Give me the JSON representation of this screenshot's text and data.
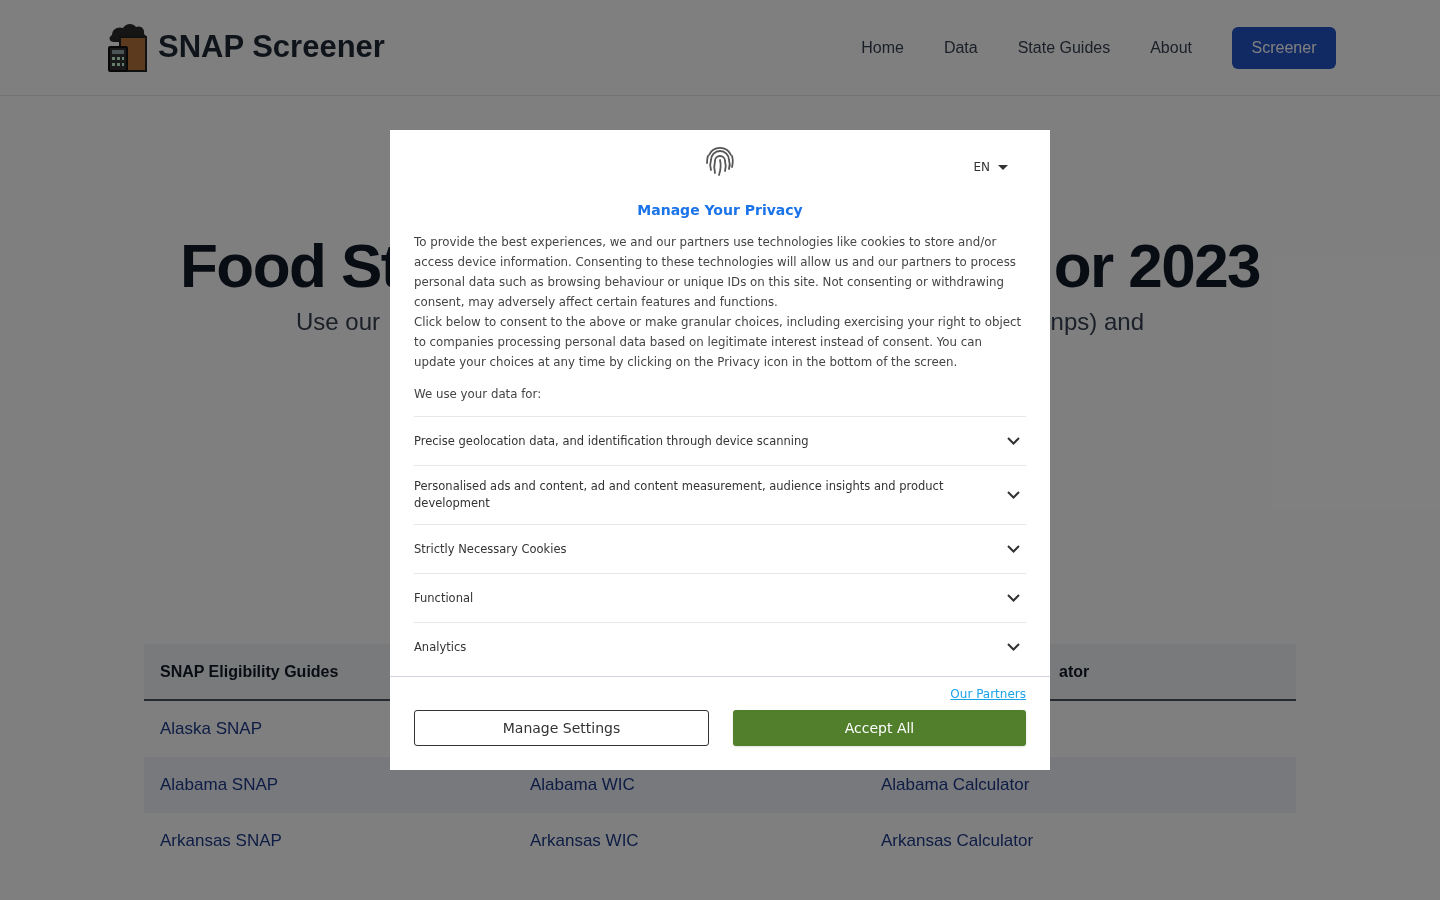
{
  "header": {
    "logo_text": "SNAP Screener",
    "nav": [
      "Home",
      "Data",
      "State Guides",
      "About"
    ],
    "cta": "Screener"
  },
  "hero": {
    "title_left": "Food St",
    "title_right": "or 2023",
    "subtitle_left": "Use our",
    "subtitle_right": "nps) and"
  },
  "table": {
    "column_1": "SNAP Eligibility Guides",
    "column_3": "ator",
    "rows": [
      {
        "cells": [
          "Alaska SNAP"
        ]
      },
      {
        "cells": [
          "Alabama SNAP",
          "Alabama WIC",
          "Alabama Calculator"
        ]
      },
      {
        "cells": [
          "Arkansas SNAP",
          "Arkansas WIC",
          "Arkansas Calculator"
        ]
      }
    ]
  },
  "consent": {
    "language": "EN",
    "title": "Manage Your Privacy",
    "paragraphs": [
      "To provide the best experiences, we and our partners use technologies like cookies to store and/or access device information. Consenting to these technologies will allow us and our partners to process personal data such as browsing behaviour or unique IDs on this site. Not consenting or withdrawing consent, may adversely affect certain features and functions.",
      "Click below to consent to the above or make granular choices, including exercising your right to object to companies processing personal data based on legitimate interest instead of consent. You can update your choices at any time by clicking on the Privacy icon in the bottom of the screen."
    ],
    "intro": "We use your data for:",
    "purposes": [
      {
        "label": "Precise geolocation data, and identification through device scanning",
        "expanded": false
      },
      {
        "label": "Personalised ads and content, ad and content measurement, audience insights and product development",
        "expanded": false
      },
      {
        "label": "Strictly Necessary Cookies",
        "expanded": false
      },
      {
        "label": "Functional",
        "expanded": false
      },
      {
        "label": "Analytics",
        "expanded": false
      }
    ],
    "partners_link": "Our Partners",
    "buttons": [
      {
        "label": "Manage Settings",
        "kind": "outline"
      },
      {
        "label": "Accept All",
        "kind": "primary"
      }
    ]
  }
}
